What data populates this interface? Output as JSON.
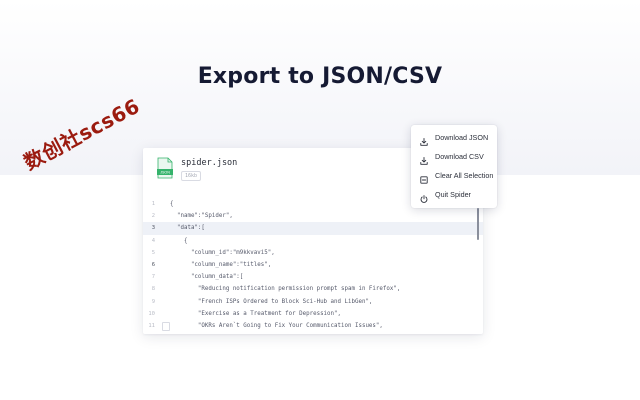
{
  "page_title": "Export to JSON/CSV",
  "watermark": "数创社scs66",
  "file": {
    "name": "spider.json",
    "size": "16kb",
    "icon_label": "JSON",
    "icon": "json-file-icon",
    "accent_color": "#35b36b"
  },
  "code_lines": [
    {
      "n": "1",
      "text": "{"
    },
    {
      "n": "2",
      "text": "  \"name\":\"Spider\","
    },
    {
      "n": "3",
      "text": "  \"data\":[",
      "highlight": true
    },
    {
      "n": "4",
      "text": "    {"
    },
    {
      "n": "5",
      "text": "      \"column_id\":\"m9kkvavi5\","
    },
    {
      "n": "6",
      "text": "      \"column_name\":\"titles\",",
      "active": true
    },
    {
      "n": "7",
      "text": "      \"column_data\":["
    },
    {
      "n": "8",
      "text": "        \"Reducing notification permission prompt spam in Firefox\","
    },
    {
      "n": "9",
      "text": "        \"French ISPs Ordered to Block Sci-Hub and LibGen\","
    },
    {
      "n": "10",
      "text": "        \"Exercise as a Treatment for Depression\","
    },
    {
      "n": "11",
      "text": "        \"OKRs Aren`t Going to Fix Your Communication Issues\",",
      "fold": true
    }
  ],
  "menu": {
    "items": [
      {
        "label": "Download JSON",
        "icon": "download-icon"
      },
      {
        "label": "Download CSV",
        "icon": "download-icon"
      },
      {
        "label": "Clear All Selection",
        "icon": "clear-selection-icon"
      },
      {
        "label": "Quit Spider",
        "icon": "power-icon"
      }
    ]
  }
}
